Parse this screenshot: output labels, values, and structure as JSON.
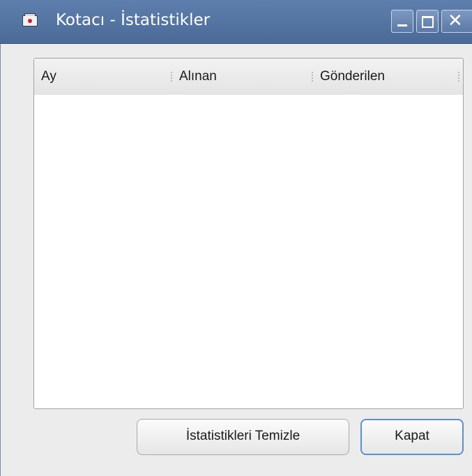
{
  "window": {
    "title": "Kotacı - İstatistikler",
    "app_icon": "mail-icon"
  },
  "titlebar_buttons": {
    "minimize": "minimize-icon",
    "maximize": "maximize-icon",
    "close_glyph": "✕"
  },
  "table": {
    "columns": [
      "Ay",
      "Alınan",
      "Gönderilen"
    ],
    "rows": []
  },
  "buttons": {
    "clear_label": "İstatistikleri Temizle",
    "close_label": "Kapat"
  },
  "colors": {
    "titlebar": "#4b6a97",
    "focus_border": "#5b8fd6",
    "background": "#ececec"
  }
}
